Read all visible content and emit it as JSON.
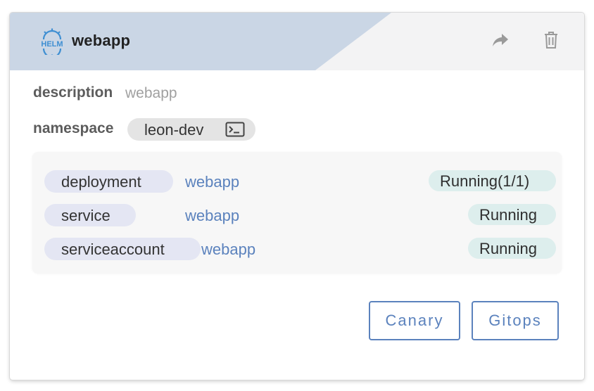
{
  "card": {
    "logo_text": "HELM",
    "title": "webapp",
    "icons": {
      "logo": "helm-icon",
      "share": "share-arrow-icon",
      "delete": "trash-icon",
      "terminal": "terminal-icon"
    }
  },
  "details": {
    "description_label": "description",
    "description_value": "webapp",
    "namespace_label": "namespace",
    "namespace_value": "leon-dev"
  },
  "resources": [
    {
      "kind": "deployment",
      "name": "webapp",
      "status": "Running(1/1)"
    },
    {
      "kind": "service",
      "name": "webapp",
      "status": "Running"
    },
    {
      "kind": "serviceaccount",
      "name": "webapp",
      "status": "Running"
    }
  ],
  "actions": {
    "canary": "Canary",
    "gitops": "Gitops"
  },
  "colors": {
    "header_band": "#cad6e5",
    "link": "#5b82bd",
    "status_bg": "#ddeeed",
    "kind_bg": "#e4e6f3",
    "helm_blue": "#3f8fd2"
  }
}
